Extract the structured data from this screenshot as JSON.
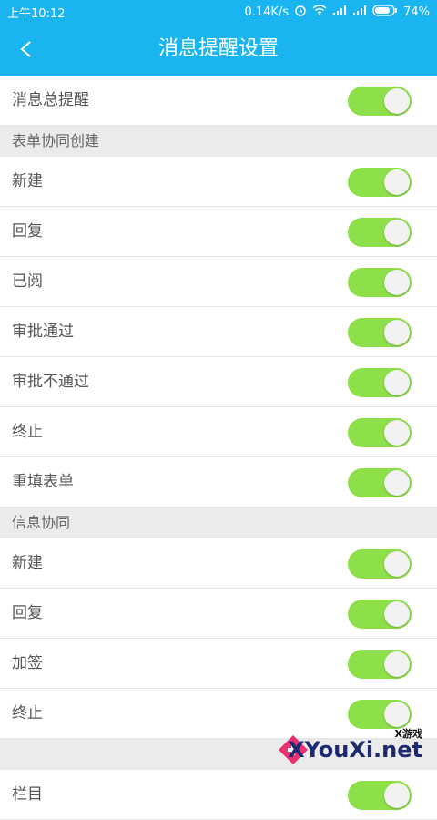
{
  "status_bar": {
    "time": "上午10:12",
    "speed": "0.14K/s",
    "battery": "74%",
    "icons": [
      "alarm-icon",
      "wifi-icon",
      "signal-icon",
      "signal-icon",
      "battery-icon"
    ]
  },
  "header": {
    "title": "消息提醒设置",
    "back_icon": "chevron-left-icon"
  },
  "master": {
    "label": "消息总提醒",
    "on": true
  },
  "sections": [
    {
      "title": "表单协同创建",
      "items": [
        {
          "label": "新建",
          "on": true
        },
        {
          "label": "回复",
          "on": true
        },
        {
          "label": "已阅",
          "on": true
        },
        {
          "label": "审批通过",
          "on": true
        },
        {
          "label": "审批不通过",
          "on": true
        },
        {
          "label": "终止",
          "on": true
        },
        {
          "label": "重填表单",
          "on": true
        }
      ]
    },
    {
      "title": "信息协同",
      "items": [
        {
          "label": "新建",
          "on": true
        },
        {
          "label": "回复",
          "on": true
        },
        {
          "label": "加签",
          "on": true
        },
        {
          "label": "终止",
          "on": true
        }
      ]
    },
    {
      "title": "",
      "items": [
        {
          "label": "栏目",
          "on": true
        }
      ]
    }
  ],
  "watermark": {
    "top_text": "X游戏",
    "main_text": "XYouXi.net"
  },
  "colors": {
    "accent": "#1ab4f0",
    "toggle_on": "#8ee04a"
  }
}
